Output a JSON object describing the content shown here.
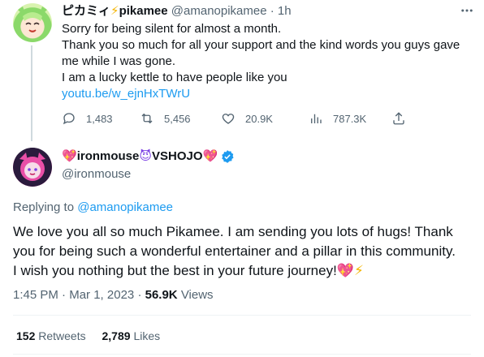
{
  "parent_tweet": {
    "display_name": "ピカミィ",
    "display_name_emoji": "⚡",
    "display_name_suffix": "pikamee",
    "handle": "@amanopikamee",
    "separator": "·",
    "timestamp": "1h",
    "more_icon": "more-icon",
    "body_lines": [
      "Sorry for being silent for almost a month.",
      "Thank you so much for all your support and the kind words you guys gave",
      "me while I was gone.",
      "I am a lucky kettle to have people like you"
    ],
    "link": "youtu.be/w_ejnHxTWrU",
    "actions": {
      "replies": "1,483",
      "retweets": "5,456",
      "likes": "20.9K",
      "views": "787.3K"
    }
  },
  "main_tweet": {
    "display_name_prefix_emoji": "💖",
    "display_name": "ironmouse",
    "display_name_mid_emoji": "😈",
    "display_name_suffix": "VSHOJO",
    "display_name_end_emoji": "💖",
    "handle": "@ironmouse",
    "replying_prefix": "Replying to",
    "replying_to": "@amanopikamee",
    "body_lines": [
      "We love you all so much Pikamee. I am sending you lots of hugs! Thank",
      "you for being such a wonderful entertainer and a pillar in this community.",
      "I wish you nothing but the best in your future journey!"
    ],
    "body_end_emojis": [
      "💖",
      "⚡"
    ],
    "time": "1:45 PM",
    "dot": "·",
    "date": "Mar 1, 2023",
    "views_count": "56.9K",
    "views_label": "Views",
    "retweets_count": "152",
    "retweets_label": "Retweets",
    "likes_count": "2,789",
    "likes_label": "Likes"
  },
  "colors": {
    "accent": "#1d9bf0",
    "muted": "#536471",
    "text": "#0f1419",
    "divider": "#eff3f4"
  }
}
